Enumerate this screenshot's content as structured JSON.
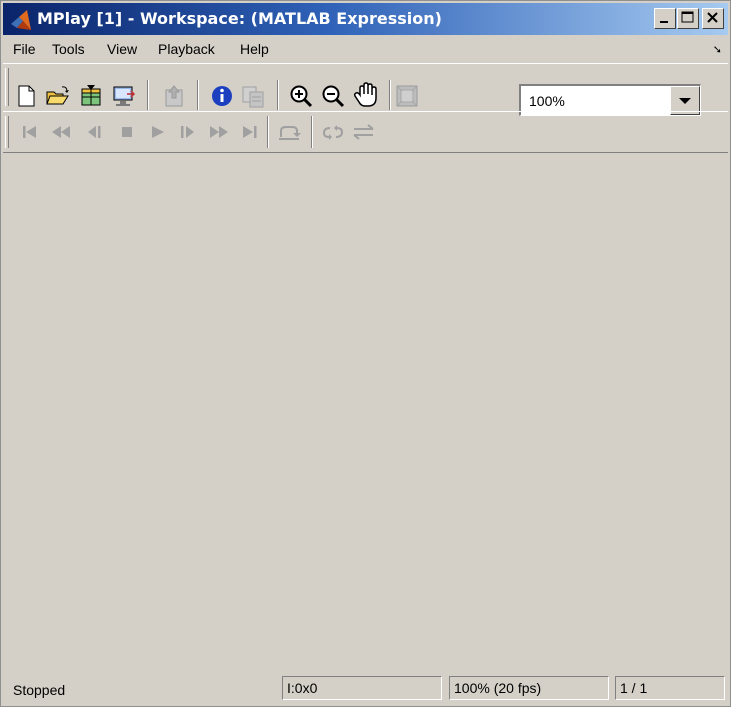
{
  "window": {
    "title": "MPlay [1] - Workspace: (MATLAB Expression)",
    "controls": {
      "minimize": "_",
      "maximize": "□",
      "close": "X"
    }
  },
  "menu": {
    "items": [
      "File",
      "Tools",
      "View",
      "Playback",
      "Help"
    ]
  },
  "toolbar": {
    "zoom_value": "100%",
    "icons": [
      "new-icon",
      "open-icon",
      "import-icon",
      "connect-icon",
      "export-icon",
      "info-icon",
      "copy-icon",
      "zoom-in-icon",
      "zoom-out-icon",
      "pan-hand-icon",
      "fit-icon"
    ]
  },
  "playback": {
    "icons": [
      "go-to-start-icon",
      "rewind-icon",
      "step-back-icon",
      "stop-icon",
      "play-icon",
      "step-forward-icon",
      "fast-forward-icon",
      "go-to-end-icon",
      "jump-to-icon",
      "loop-icon",
      "autoreverse-icon"
    ]
  },
  "status": {
    "state": "Stopped",
    "dims": "I:0x0",
    "rate": "100% (20 fps)",
    "frame": "1 / 1"
  },
  "colors": {
    "title_start": "#0a246a",
    "title_end": "#a6caf0",
    "face": "#d4d0c8",
    "disabled_icon": "#a0a0a0"
  }
}
